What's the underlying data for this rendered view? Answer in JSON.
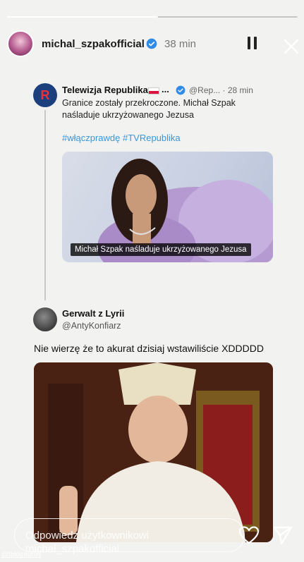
{
  "story": {
    "progress": 0.52,
    "username": "michal_szpakofficial",
    "time": "38 min"
  },
  "tweet1": {
    "author": "Telewizja Republika",
    "dots": "...",
    "handle": "@Rep... · 28 min",
    "text": "Granice zostały przekroczone. Michał Szpak naśladuje ukrzyżowanego Jezusa",
    "hashtags": "#włączprawdę #TVRepublika",
    "caption": "Michał Szpak naśladuje ukrzyżowanego Jezusa",
    "logo_letter": "R"
  },
  "tweet2": {
    "author": "Gerwalt z Lyrii",
    "handle": "@AntyKonfiarz",
    "text": "Nie wierzę że to akurat dzisiaj wstawiliście XDDDDD"
  },
  "reply": {
    "placeholder": "Odpowiedz użytkownikowi michal_szpakofficial"
  },
  "credit": "@telozaurus",
  "icons": {
    "verified": "verified-badge-icon",
    "pause": "pause-icon",
    "close": "close-icon",
    "heart": "heart-icon",
    "send": "send-icon"
  },
  "colors": {
    "accent_blue": "#3b96d6",
    "verified_blue": "#2f8be6",
    "logo_navy": "#1c3f7d",
    "logo_red": "#e8313a"
  }
}
